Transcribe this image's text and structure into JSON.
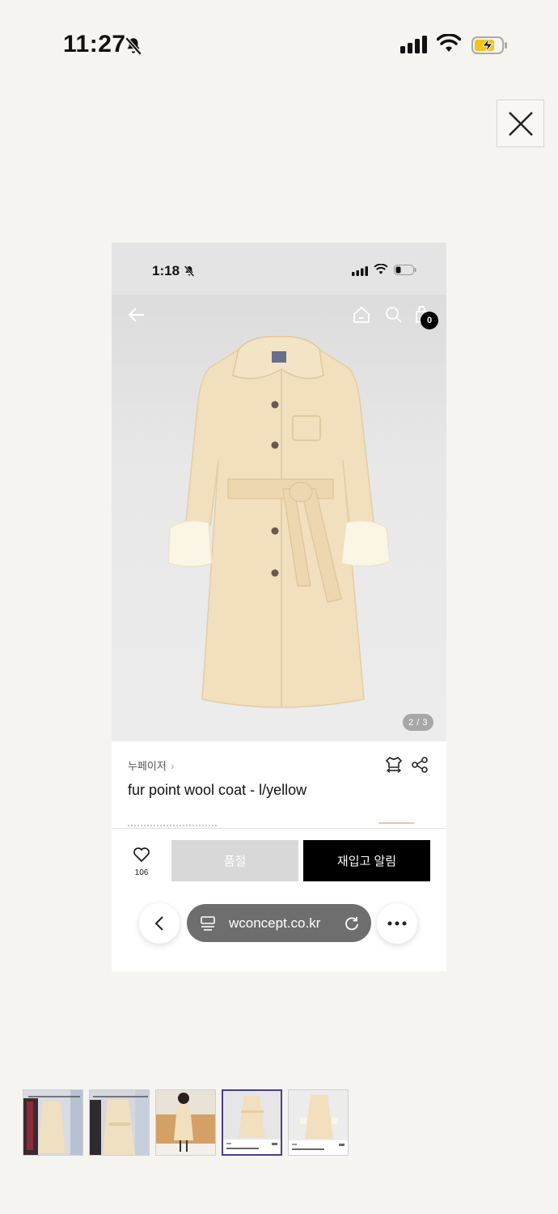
{
  "outer_status": {
    "time": "11:27"
  },
  "close": {
    "label": "close"
  },
  "inner_status": {
    "time": "1:18"
  },
  "header": {
    "cart_count": "0"
  },
  "gallery": {
    "pager": "2 / 3"
  },
  "product": {
    "brand": "누페이저",
    "title": "fur point wool coat - l/yellow"
  },
  "actions": {
    "wishlist_count": "106",
    "soldout_label": "품절",
    "restock_label": "재입고 알림"
  },
  "browser": {
    "url": "wconcept.co.kr"
  },
  "thumbnails": [
    {
      "name": "rack-photo-1",
      "active": false
    },
    {
      "name": "rack-photo-2",
      "active": false
    },
    {
      "name": "model-photo",
      "active": false
    },
    {
      "name": "product-screenshot-current",
      "active": true
    },
    {
      "name": "product-screenshot-alt",
      "active": false
    }
  ],
  "colors": {
    "accent": "#000000",
    "coat": "#f1dfbd",
    "thumb_active": "#4b3b8f"
  }
}
